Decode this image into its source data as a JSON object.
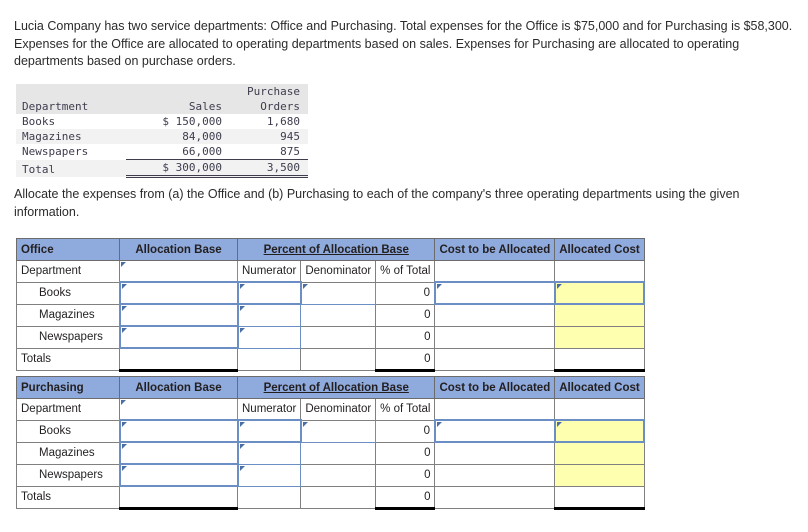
{
  "intro": {
    "paragraph": "Lucia Company has two service departments: Office and Purchasing. Total expenses for the Office is $75,000 and for Purchasing is $58,300. Expenses for the Office are allocated to operating departments based on sales. Expenses for Purchasing are allocated to operating departments based on purchase orders."
  },
  "instruction": {
    "paragraph": "Allocate the expenses from (a) the Office and (b) Purchasing to each of the company's three operating departments using the given information."
  },
  "given_data": {
    "headers": {
      "department": "Department",
      "sales": "Sales",
      "purchase_orders_line1": "Purchase",
      "purchase_orders_line2": "Orders"
    },
    "rows": [
      {
        "department": "Books",
        "sales": "$ 150,000",
        "purchase_orders": "1,680"
      },
      {
        "department": "Magazines",
        "sales": "84,000",
        "purchase_orders": "945"
      },
      {
        "department": "Newspapers",
        "sales": "66,000",
        "purchase_orders": "875"
      }
    ],
    "total": {
      "department": "Total",
      "sales": "$ 300,000",
      "purchase_orders": "3,500"
    }
  },
  "colors": {
    "header_blue": "#8faadc",
    "input_border_blue": "#6b8fc4",
    "highlight_yellow": "#ffffb0",
    "grid_gray": "#808080"
  },
  "worksheets": [
    {
      "id": "office",
      "title": "Office",
      "headers": {
        "allocation_base": "Allocation Base",
        "percent_of_allocation_base": "Percent of Allocation Base",
        "cost_to_be_allocated": "Cost to be Allocated",
        "allocated_cost": "Allocated Cost"
      },
      "subheaders": {
        "department": "Department",
        "numerator": "Numerator",
        "denominator": "Denominator",
        "percent_of_total": "% of Total"
      },
      "rows": [
        {
          "label": "Books",
          "allocation_base": "",
          "numerator": "",
          "denominator": "",
          "percent_of_total": "0",
          "cost_to_be_allocated": "",
          "allocated_cost": ""
        },
        {
          "label": "Magazines",
          "allocation_base": "",
          "numerator": "",
          "denominator": "",
          "percent_of_total": "0",
          "cost_to_be_allocated": "",
          "allocated_cost": ""
        },
        {
          "label": "Newspapers",
          "allocation_base": "",
          "numerator": "",
          "denominator": "",
          "percent_of_total": "0",
          "cost_to_be_allocated": "",
          "allocated_cost": ""
        }
      ],
      "totals": {
        "label": "Totals",
        "allocation_base": "",
        "numerator": "",
        "denominator": "",
        "percent_of_total": "0",
        "cost_to_be_allocated": "",
        "allocated_cost": ""
      }
    },
    {
      "id": "purchasing",
      "title": "Purchasing",
      "headers": {
        "allocation_base": "Allocation Base",
        "percent_of_allocation_base": "Percent of Allocation Base",
        "cost_to_be_allocated": "Cost to be Allocated",
        "allocated_cost": "Allocated Cost"
      },
      "subheaders": {
        "department": "Department",
        "numerator": "Numerator",
        "denominator": "Denominator",
        "percent_of_total": "% of Total"
      },
      "rows": [
        {
          "label": "Books",
          "allocation_base": "",
          "numerator": "",
          "denominator": "",
          "percent_of_total": "0",
          "cost_to_be_allocated": "",
          "allocated_cost": ""
        },
        {
          "label": "Magazines",
          "allocation_base": "",
          "numerator": "",
          "denominator": "",
          "percent_of_total": "0",
          "cost_to_be_allocated": "",
          "allocated_cost": ""
        },
        {
          "label": "Newspapers",
          "allocation_base": "",
          "numerator": "",
          "denominator": "",
          "percent_of_total": "0",
          "cost_to_be_allocated": "",
          "allocated_cost": ""
        }
      ],
      "totals": {
        "label": "Totals",
        "allocation_base": "",
        "numerator": "",
        "denominator": "",
        "percent_of_total": "0",
        "cost_to_be_allocated": "",
        "allocated_cost": ""
      }
    }
  ]
}
